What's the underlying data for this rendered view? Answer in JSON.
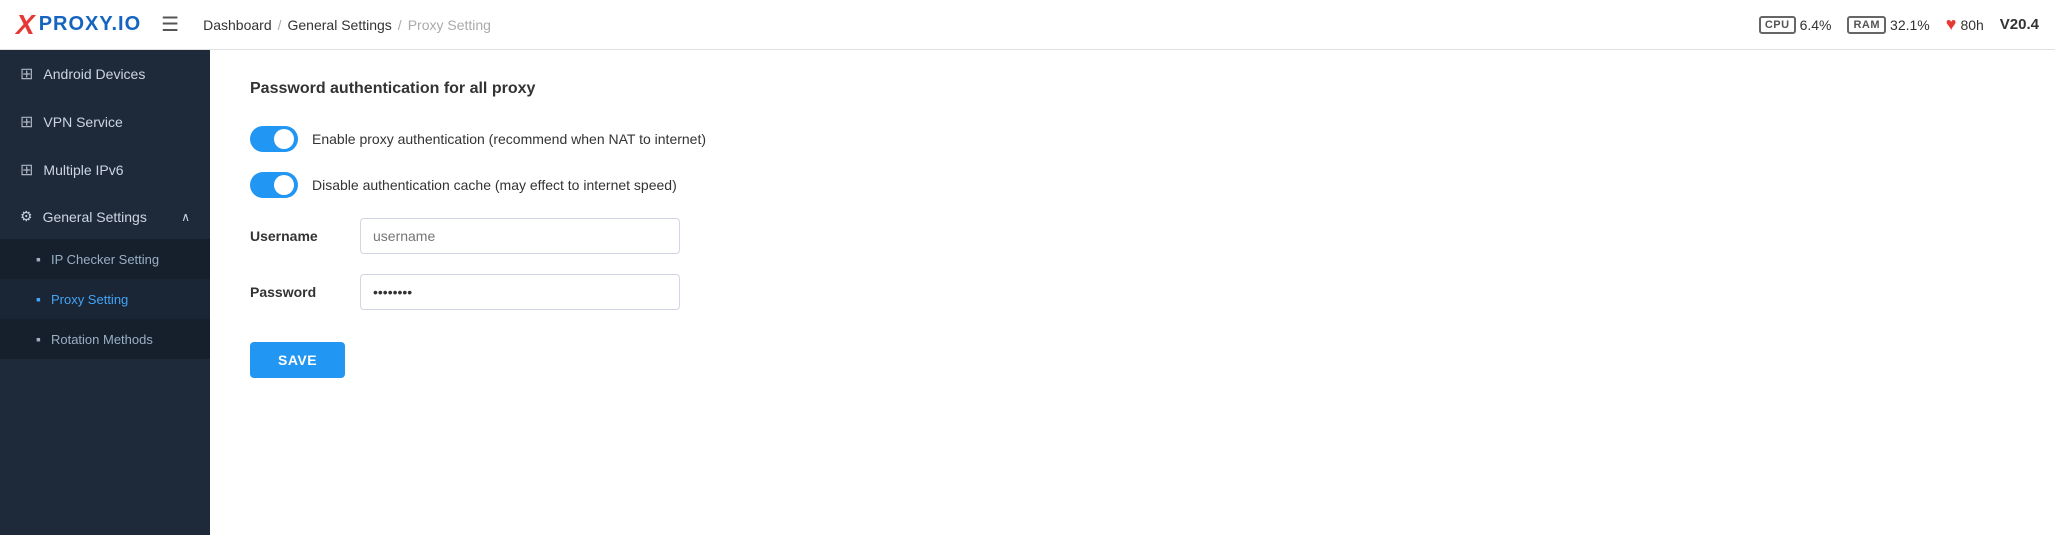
{
  "header": {
    "logo_x": "X",
    "logo_text": "PROXY.IO",
    "breadcrumb": {
      "dashboard": "Dashboard",
      "general_settings": "General Settings",
      "current": "Proxy Setting"
    },
    "stats": {
      "cpu_label": "CPU",
      "cpu_value": "6.4%",
      "ram_label": "RAM",
      "ram_value": "32.1%",
      "uptime": "80h",
      "version": "V20.4"
    }
  },
  "sidebar": {
    "items": [
      {
        "id": "android-devices",
        "label": "Android Devices",
        "icon": "⊞"
      },
      {
        "id": "vpn-service",
        "label": "VPN Service",
        "icon": "⊞"
      },
      {
        "id": "multiple-ipv6",
        "label": "Multiple IPv6",
        "icon": "⊞"
      }
    ],
    "general_settings": {
      "label": "General Settings",
      "icon": "⚙",
      "sub_items": [
        {
          "id": "ip-checker",
          "label": "IP Checker Setting",
          "icon": "▪"
        },
        {
          "id": "proxy-setting",
          "label": "Proxy Setting",
          "icon": "▪",
          "active": true
        },
        {
          "id": "rotation-methods",
          "label": "Rotation Methods",
          "icon": "▪"
        }
      ]
    }
  },
  "content": {
    "section_title": "Password authentication for all proxy",
    "toggle1": {
      "label": "Enable proxy authentication (recommend when NAT to internet)",
      "enabled": true
    },
    "toggle2": {
      "label": "Disable authentication cache (may effect to internet speed)",
      "enabled": true
    },
    "username_label": "Username",
    "username_placeholder": "username",
    "password_label": "Password",
    "password_value": "••••••••",
    "save_button": "SAVE"
  }
}
